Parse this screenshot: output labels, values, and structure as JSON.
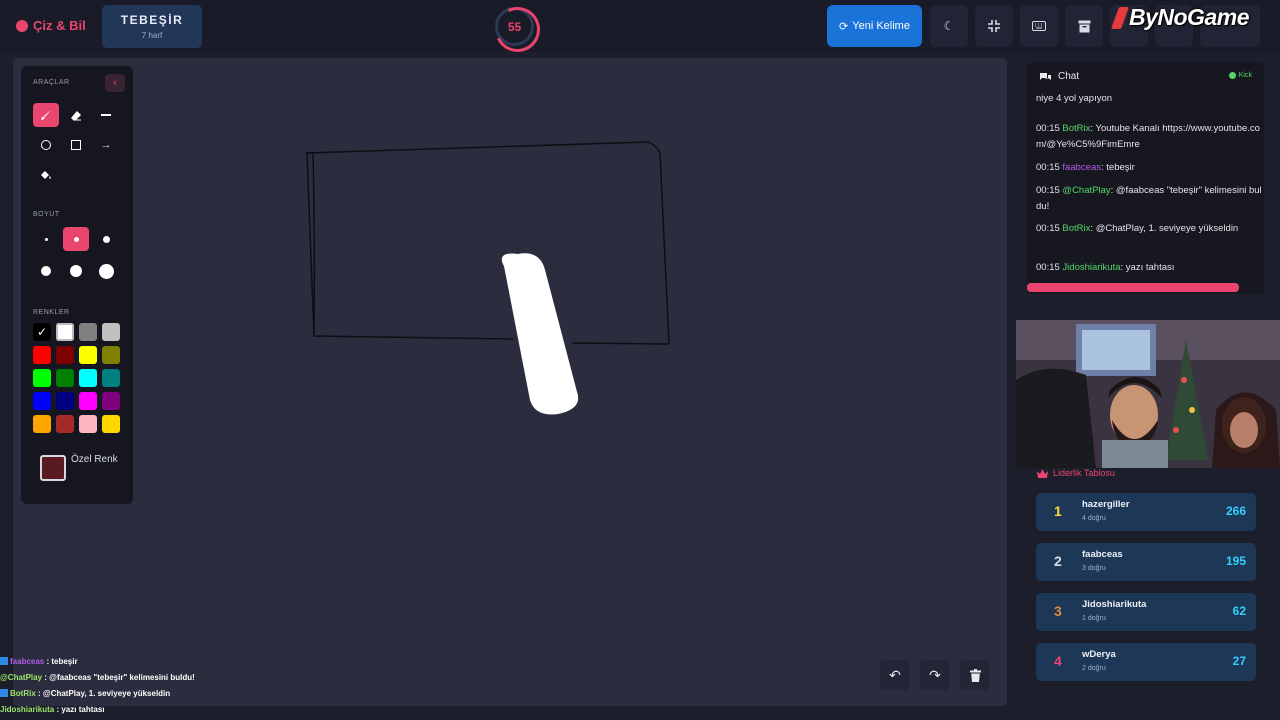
{
  "header": {
    "app_name": "Çiz & Bil",
    "word": "TEBEŞİR",
    "hint": "7 harf",
    "timer": "55",
    "new_word_label": "Yeni Kelime",
    "logo": "ByNoGame",
    "icons": [
      "palette-icon",
      "refresh-icon",
      "moon-icon",
      "compress-icon",
      "keyboard-icon",
      "archive-icon"
    ]
  },
  "tools": {
    "tools_label": "ARAÇLAR",
    "size_label": "BOYUT",
    "colors_label": "RENKLER",
    "custom_color_label": "Özel Renk",
    "active_tool": "brush",
    "active_size_index": 1,
    "colors": [
      "#000000",
      "#ffffff",
      "#808080",
      "#c0c0c0",
      "#ff0000",
      "#800000",
      "#ffff00",
      "#808000",
      "#00ff00",
      "#008000",
      "#00ffff",
      "#008080",
      "#0000ff",
      "#000080",
      "#ff00ff",
      "#800080",
      "#ffa500",
      "#a52a2a",
      "#ffb6c1",
      "#ffd700"
    ],
    "selected_color_index": 0,
    "custom_color": "#5a1a22"
  },
  "overlay_chat": [
    {
      "user": "faabceas",
      "color": "#b65cf0",
      "badge": true,
      "sep": " : ",
      "msg": "tebeşir"
    },
    {
      "user": "@ChatPlay",
      "color": "#9ee66b",
      "badge": false,
      "sep": " : ",
      "msg": "@faabceas \"tebeşir\" kelimesini buldu!"
    },
    {
      "user": "BotRix",
      "color": "#9ee66b",
      "badge": true,
      "sep": " : ",
      "msg": "@ChatPlay, 1. seviyeye yükseldin"
    },
    {
      "user": "Jidoshiarikuta",
      "color": "#9ee66b",
      "badge": false,
      "sep": " : ",
      "msg": "yazı tahtası"
    }
  ],
  "chat": {
    "title": "Chat",
    "platform": "Kick",
    "messages": [
      {
        "text": "niye 4 yol yapıyon"
      },
      {
        "time": "00:15",
        "user": "BotRix",
        "color": "#53d769",
        "text": "Youtube Kanalı https://www.youtube.com/@Ye%C5%9FimEmre"
      },
      {
        "time": "00:15",
        "user": "faabceas",
        "color": "#b65cf0",
        "text": "tebeşir"
      },
      {
        "time": "00:15",
        "user": "@ChatPlay",
        "color": "#53d769",
        "text": "@faabceas \"tebeşir\" kelimesini buldu!"
      },
      {
        "time": "00:15",
        "user": "BotRix",
        "color": "#53d769",
        "text": "@ChatPlay, 1. seviyeye yükseldin"
      },
      {
        "time": "00:15",
        "user": "Jidoshiarikuta",
        "color": "#53d769",
        "text": "yazı tahtası"
      }
    ]
  },
  "leaderboard": {
    "title": "Liderlik Tablosu",
    "rows": [
      {
        "rank": "1",
        "name": "hazergiller",
        "sub": "4 doğru",
        "score": "266",
        "rank_color": "#ffd43b"
      },
      {
        "rank": "2",
        "name": "faabceas",
        "sub": "3 doğru",
        "score": "195",
        "rank_color": "#d9dde6"
      },
      {
        "rank": "3",
        "name": "Jidoshiarikuta",
        "sub": "1 doğru",
        "score": "62",
        "rank_color": "#e0883a"
      },
      {
        "rank": "4",
        "name": "wDerya",
        "sub": "2 doğru",
        "score": "27",
        "rank_color": "#e9456e"
      }
    ]
  }
}
